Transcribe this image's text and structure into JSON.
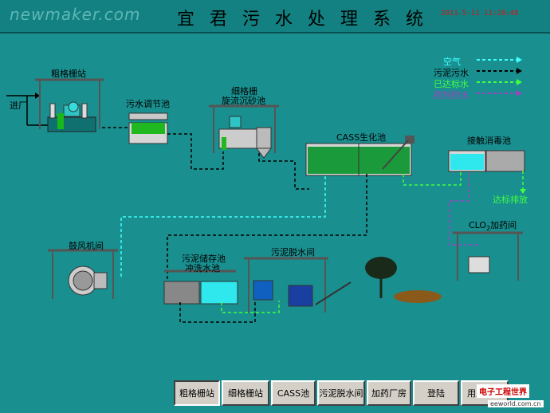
{
  "header": {
    "logo": "newmaker.com",
    "title": "宜 君 污 水 处 理 系 统",
    "datetime": "2011-5-11  11:28:48"
  },
  "legend": [
    {
      "label": "空气",
      "color": "#40ffff"
    },
    {
      "label": "污泥污水",
      "color": "#000000"
    },
    {
      "label": "已达标水",
      "color": "#40ff40"
    },
    {
      "label": "药剂药水",
      "color": "#a040c0"
    }
  ],
  "labels": {
    "inlet": "进厂",
    "coarse_screen": "粗格栅站",
    "regulating_tank": "污水调节池",
    "fine_screen_1": "细格栅",
    "fine_screen_2": "旋流沉砂池",
    "cass": "CASS生化池",
    "disinfection": "接触消毒池",
    "discharge": "达标排放",
    "clo2": "CLO",
    "clo2_sub": "2",
    "clo2_suffix": "加药间",
    "blower": "鼓风机间",
    "sludge_store_1": "污泥储存池",
    "sludge_store_2": "冲洗水池",
    "dewatering": "污泥脱水间"
  },
  "nav": [
    {
      "label": "粗格栅站"
    },
    {
      "label": "细格栅站"
    },
    {
      "label": "CASS池"
    },
    {
      "label": "污泥脱水间"
    },
    {
      "label": "加药厂房"
    },
    {
      "label": "登陆"
    },
    {
      "label": "用户管理"
    }
  ],
  "watermark": {
    "line1": "电子工程世界",
    "line2": "eeworld.com.cn"
  }
}
